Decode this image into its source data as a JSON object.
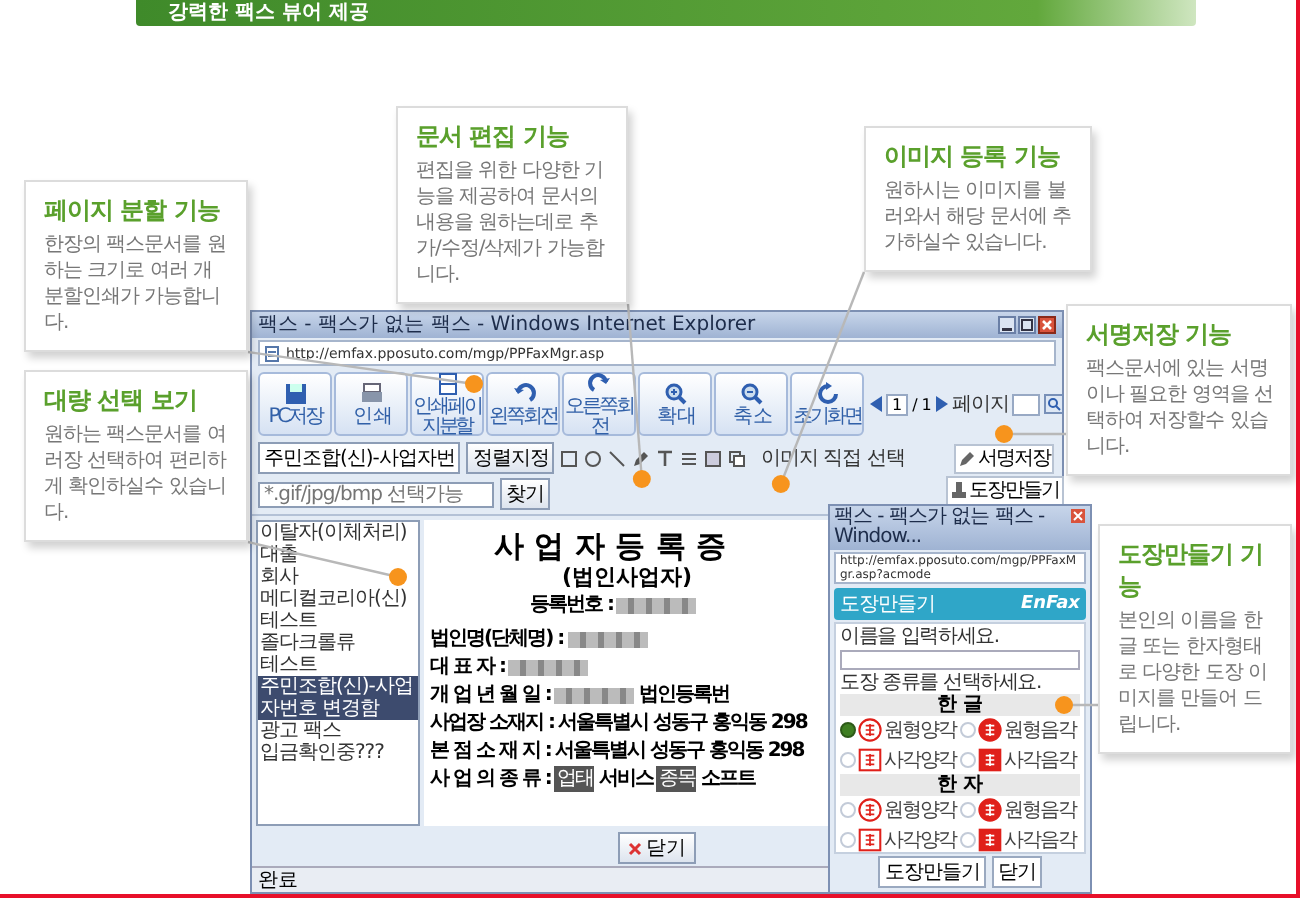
{
  "banner": {
    "title": "강력한 팩스 뷰어 제공"
  },
  "callouts": [
    {
      "title": "문서 편집 기능",
      "text": "편집을 위한 다양한 기능을 제공하여 문서의 내용을 원하는데로 추가/수정/삭제가 가능합니다."
    },
    {
      "title": "이미지 등록 기능",
      "text": "원하시는 이미지를 불러와서 해당 문서에 추가하실수 있습니다."
    },
    {
      "title": "페이지 분할 기능",
      "text": "한장의 팩스문서를 원하는 크기로 여러 개 분할인쇄가 가능합니다."
    },
    {
      "title": "서명저장 기능",
      "text": "팩스문서에 있는 서명이나 필요한 영역을 선택하여 저장할수 있습니다."
    },
    {
      "title": "대량 선택 보기",
      "text": "원하는 팩스문서를 여러장 선택하여 편리하게 확인하실수 있습니다."
    },
    {
      "title": "도장만들기 기능",
      "text": "본인의 이름을 한글 또는 한자형태로 다양한 도장 이미지를 만들어 드립니다."
    }
  ],
  "window": {
    "title": "팩스 - 팩스가 없는 팩스 - Windows Internet Explorer",
    "address": "http://emfax.pposuto.com/mgp/PPFaxMgr.asp"
  },
  "toolbar": {
    "buttons": [
      {
        "label": "PC저장"
      },
      {
        "label": "인 쇄"
      },
      {
        "label": "인쇄페이지분할"
      },
      {
        "label": "왼쪽회전"
      },
      {
        "label": "오른쪽회전"
      },
      {
        "label": "확 대"
      },
      {
        "label": "축 소"
      },
      {
        "label": "초기화면"
      }
    ],
    "page_current": "1",
    "page_separator": "/",
    "page_total": "1",
    "page_label": "페이지"
  },
  "edit_toolbar": {
    "sort_select": "주민조합(신)-사업자번",
    "sort_button": "정렬지정",
    "image_label": "이미지 직접 선택",
    "image_placeholder": "*.gif/jpg/bmp 선택가능",
    "browse_button": "찾기"
  },
  "fax_list": [
    {
      "label": "이탈자(이체처리)",
      "selected": false
    },
    {
      "label": "대출",
      "selected": false
    },
    {
      "label": "회사",
      "selected": false
    },
    {
      "label": "메디컬코리아(신)",
      "selected": false
    },
    {
      "label": "테스트",
      "selected": false
    },
    {
      "label": "졸다크롤류",
      "selected": false
    },
    {
      "label": "테스트",
      "selected": false
    },
    {
      "label": "주민조합(신)-사업자번호 변경함",
      "selected": true
    },
    {
      "label": "광고 팩스",
      "selected": false
    },
    {
      "label": "입금확인중???",
      "selected": false
    }
  ],
  "document": {
    "title": "사 업 자 등 록 증",
    "subtitle": "(법인사업자)",
    "reg_label": "등록번호 :",
    "rows": [
      {
        "label": "법인명(단체명) :",
        "parts": [
          {
            "kind": "redacted"
          }
        ]
      },
      {
        "label": "대 표 자 :",
        "parts": [
          {
            "kind": "redacted"
          }
        ]
      },
      {
        "label": "개 업 년 월 일 :",
        "parts": [
          {
            "kind": "redacted"
          },
          {
            "kind": "text",
            "text": "법인등록번"
          }
        ]
      },
      {
        "label": "사업장 소재지 :",
        "parts": [
          {
            "kind": "text",
            "text": "서울특별시 성동구 홍익동 298"
          }
        ]
      },
      {
        "label": "본 점 소 재 지 :",
        "parts": [
          {
            "kind": "text",
            "text": "서울특별시 성동구 홍익동 298"
          }
        ]
      },
      {
        "label": "사 업 의 종 류 :",
        "parts": [
          {
            "kind": "tag",
            "text": "업태"
          },
          {
            "kind": "text",
            "text": "서비스"
          },
          {
            "kind": "tag",
            "text": "종목"
          },
          {
            "kind": "text",
            "text": "소프트"
          }
        ]
      }
    ]
  },
  "side_buttons": [
    {
      "label": "서명저장"
    },
    {
      "label": "도장만들기"
    }
  ],
  "close_button": "닫기",
  "status_bar": "완료",
  "stamp_popup": {
    "title": "팩스 - 팩스가 없는 팩스 - Window...",
    "address": "http://emfax.pposuto.com/mgp/PPFaxMgr.asp?acmode",
    "header": "도장만들기",
    "logo": "EnFax",
    "name_prompt": "이름을 입력하세요.",
    "type_prompt": "도장 종류를 선택하세요.",
    "groups": [
      {
        "title": "한 글",
        "options": [
          {
            "label": "원형양각",
            "kind": "circle_outline",
            "selected": true
          },
          {
            "label": "원형음각",
            "kind": "circle_solid",
            "selected": false
          },
          {
            "label": "사각양각",
            "kind": "square_outline",
            "selected": false
          },
          {
            "label": "사각음각",
            "kind": "square_solid",
            "selected": false
          }
        ]
      },
      {
        "title": "한 자",
        "options": [
          {
            "label": "원형양각",
            "kind": "circle_outline",
            "selected": false
          },
          {
            "label": "원형음각",
            "kind": "circle_solid",
            "selected": false
          },
          {
            "label": "사각양각",
            "kind": "square_outline",
            "selected": false
          },
          {
            "label": "사각음각",
            "kind": "square_solid",
            "selected": false
          }
        ]
      }
    ],
    "buttons": [
      {
        "label": "도장만들기"
      },
      {
        "label": "닫기"
      }
    ]
  }
}
